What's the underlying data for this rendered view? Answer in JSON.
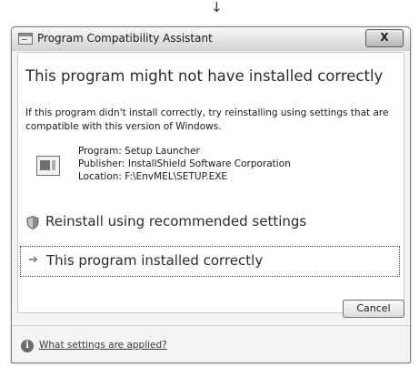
{
  "window": {
    "title": "Program Compatibility Assistant",
    "close_label": "X"
  },
  "content": {
    "heading": "This program might not have installed correctly",
    "description": "If this program didn't install correctly, try reinstalling using settings that are compatible with this version of Windows.",
    "program": {
      "name_line": "Program: Setup Launcher",
      "publisher_line": "Publisher: InstallShield Software Corporation",
      "location_line": "Location: F:\\EnvMEL\\SETUP.EXE"
    },
    "options": [
      {
        "label": "Reinstall using recommended settings",
        "icon": "shield-icon"
      },
      {
        "label": "This program installed correctly",
        "icon": "arrow-right-icon"
      }
    ]
  },
  "buttons": {
    "cancel_label": "Cancel"
  },
  "footer": {
    "help_link": "What settings are applied?"
  },
  "annotation": {
    "arrow": "↓"
  }
}
